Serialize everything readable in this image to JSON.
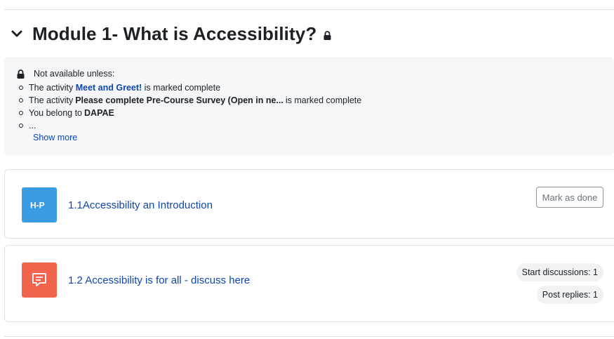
{
  "section": {
    "title": "Module 1- What is Accessibility?",
    "icons": {
      "toggle": "chevron-down-icon",
      "lock": "lock-icon"
    }
  },
  "restriction": {
    "heading": "Not available unless:",
    "items": [
      {
        "prefix": "The activity",
        "link": "Meet and Greet!",
        "suffix": "is marked complete"
      },
      {
        "prefix": "The activity",
        "strong": "Please complete Pre-Course Survey (Open in ne...",
        "suffix": "is marked complete"
      },
      {
        "prefix": "You belong to",
        "strong": "DAPAE"
      },
      {
        "prefix": "..."
      }
    ],
    "show_more": "Show more"
  },
  "activities": [
    {
      "icon": "h5p-icon",
      "icon_text": "H-P",
      "icon_color": "#399be2",
      "title": "1.1Accessibility an Introduction",
      "button": "Mark as done"
    },
    {
      "icon": "forum-icon",
      "icon_color": "#f0644d",
      "title": "1.2 Accessibility is for all - discuss here",
      "badges": [
        "Start discussions: 1",
        "Post replies: 1"
      ]
    }
  ],
  "colors": {
    "link": "#0f47ad",
    "panel_bg": "#f5f6f8",
    "border": "#dee2e6"
  }
}
